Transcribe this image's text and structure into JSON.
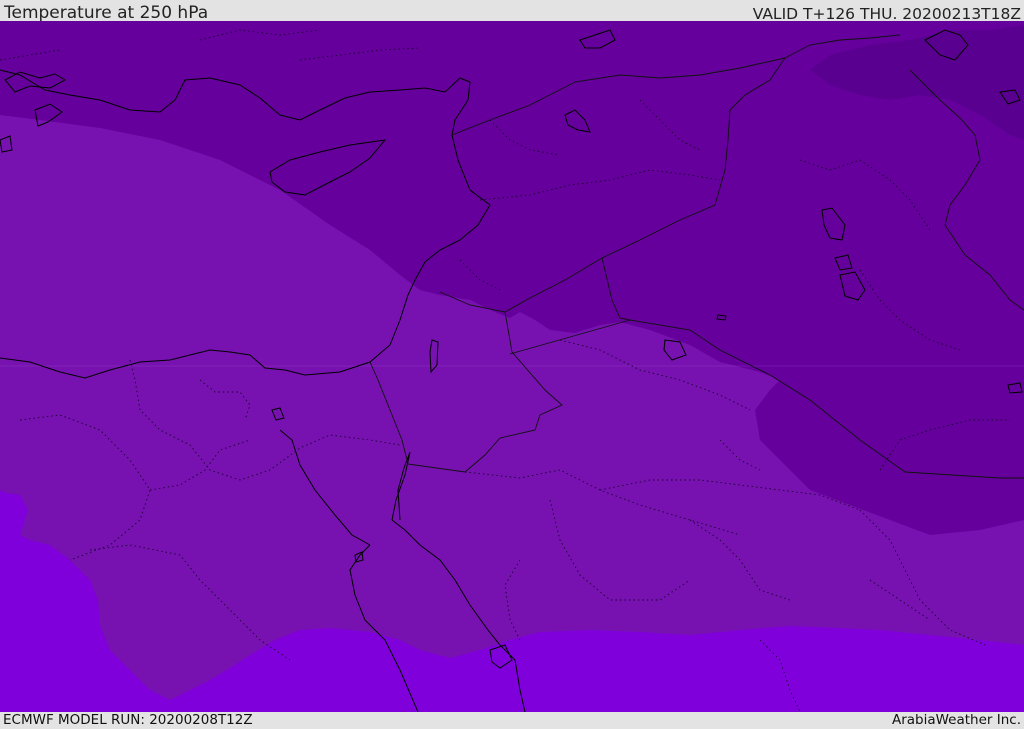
{
  "header": {
    "title": "Temperature at 250 hPa",
    "valid_time": "VALID T+126 THU. 20200213T18Z"
  },
  "footer": {
    "model_run": "ECMWF MODEL RUN: 20200208T12Z",
    "credit": "ArabiaWeather Inc."
  },
  "map": {
    "variable": "Temperature",
    "level": "250 hPa",
    "colors": {
      "band_deep": "#5a0090",
      "band_dark": "#65009c",
      "band_mid": "#7712b0",
      "band_light": "#8000dc",
      "coastline": "#000000",
      "border": "#111111"
    }
  }
}
